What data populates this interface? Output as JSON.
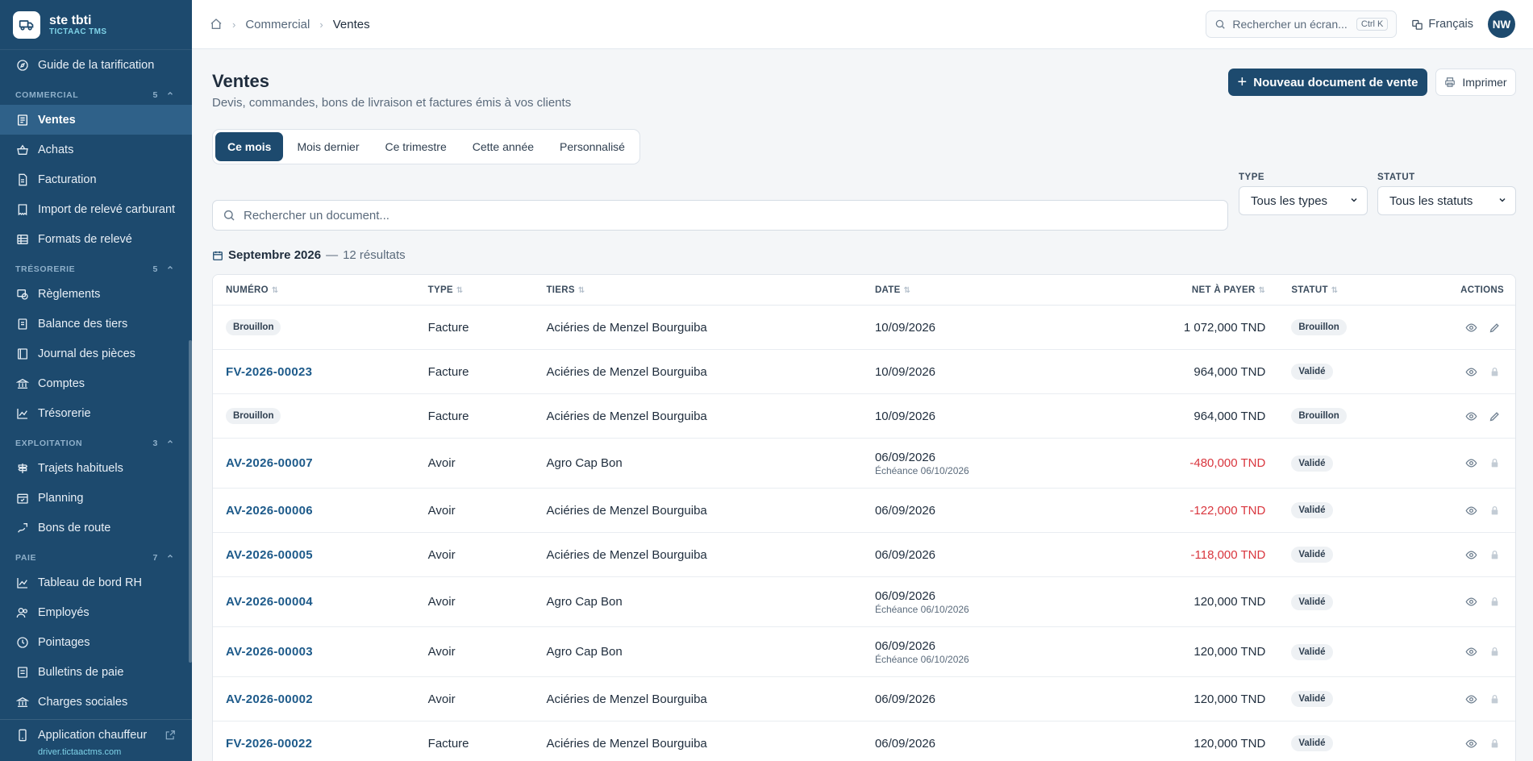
{
  "brand": {
    "name": "ste tbti",
    "subtitle": "TICTAAC TMS"
  },
  "sidebar": {
    "top_item": {
      "label": "Guide de la tarification",
      "icon": "compass-icon"
    },
    "sections": [
      {
        "title": "COMMERCIAL",
        "count": "5",
        "items": [
          {
            "label": "Ventes",
            "icon": "document-icon",
            "active": true
          },
          {
            "label": "Achats",
            "icon": "basket-icon"
          },
          {
            "label": "Facturation",
            "icon": "invoice-icon"
          },
          {
            "label": "Import de relevé carburant",
            "icon": "receipt-icon"
          },
          {
            "label": "Formats de relevé",
            "icon": "grid-icon"
          }
        ]
      },
      {
        "title": "TRÉSORERIE",
        "count": "5",
        "items": [
          {
            "label": "Règlements",
            "icon": "payment-icon"
          },
          {
            "label": "Balance des tiers",
            "icon": "balance-icon"
          },
          {
            "label": "Journal des pièces",
            "icon": "journal-icon"
          },
          {
            "label": "Comptes",
            "icon": "bank-icon"
          },
          {
            "label": "Trésorerie",
            "icon": "chart-line-icon"
          }
        ]
      },
      {
        "title": "EXPLOITATION",
        "count": "3",
        "items": [
          {
            "label": "Trajets habituels",
            "icon": "signpost-icon"
          },
          {
            "label": "Planning",
            "icon": "calendar-icon"
          },
          {
            "label": "Bons de route",
            "icon": "route-icon"
          }
        ]
      },
      {
        "title": "PAIE",
        "count": "7",
        "items": [
          {
            "label": "Tableau de bord RH",
            "icon": "chart-line-icon"
          },
          {
            "label": "Employés",
            "icon": "users-icon"
          },
          {
            "label": "Pointages",
            "icon": "clock-icon"
          },
          {
            "label": "Bulletins de paie",
            "icon": "payslip-icon"
          },
          {
            "label": "Charges sociales",
            "icon": "bank-icon"
          }
        ]
      }
    ],
    "footer": {
      "app_label": "Application chauffeur",
      "url": "driver.tictaactms.com"
    }
  },
  "topbar": {
    "breadcrumb": [
      "Commercial",
      "Ventes"
    ],
    "search_placeholder": "Rechercher un écran...",
    "shortcut": "Ctrl K",
    "language": "Français",
    "avatar_initials": "NW"
  },
  "page": {
    "title": "Ventes",
    "subtitle": "Devis, commandes, bons de livraison et factures émis à vos clients",
    "new_button": "Nouveau document de vente",
    "print_button": "Imprimer"
  },
  "periods": [
    "Ce mois",
    "Mois dernier",
    "Ce trimestre",
    "Cette année",
    "Personnalisé"
  ],
  "active_period": "Ce mois",
  "filters": {
    "type_label": "TYPE",
    "type_value": "Tous les types",
    "status_label": "STATUT",
    "status_value": "Tous les statuts"
  },
  "doc_search_placeholder": "Rechercher un document...",
  "results": {
    "month": "Septembre 2026",
    "dash": "—",
    "count": "12 résultats"
  },
  "table": {
    "headers": {
      "num": "NUMÉRO",
      "type": "TYPE",
      "tiers": "TIERS",
      "date": "DATE",
      "net": "NET À PAYER",
      "status": "STATUT",
      "actions": "ACTIONS"
    },
    "rows": [
      {
        "num": "Brouillon",
        "draft": true,
        "type": "Facture",
        "tiers": "Aciéries de Menzel Bourguiba",
        "date": "10/09/2026",
        "due": "",
        "net": "1 072,000 TND",
        "negative": false,
        "status": "Brouillon",
        "editable": true
      },
      {
        "num": "FV-2026-00023",
        "draft": false,
        "type": "Facture",
        "tiers": "Aciéries de Menzel Bourguiba",
        "date": "10/09/2026",
        "due": "",
        "net": "964,000 TND",
        "negative": false,
        "status": "Validé",
        "editable": false
      },
      {
        "num": "Brouillon",
        "draft": true,
        "type": "Facture",
        "tiers": "Aciéries de Menzel Bourguiba",
        "date": "10/09/2026",
        "due": "",
        "net": "964,000 TND",
        "negative": false,
        "status": "Brouillon",
        "editable": true
      },
      {
        "num": "AV-2026-00007",
        "draft": false,
        "type": "Avoir",
        "tiers": "Agro Cap Bon",
        "date": "06/09/2026",
        "due": "Échéance 06/10/2026",
        "net": "-480,000 TND",
        "negative": true,
        "status": "Validé",
        "editable": false
      },
      {
        "num": "AV-2026-00006",
        "draft": false,
        "type": "Avoir",
        "tiers": "Aciéries de Menzel Bourguiba",
        "date": "06/09/2026",
        "due": "",
        "net": "-122,000 TND",
        "negative": true,
        "status": "Validé",
        "editable": false
      },
      {
        "num": "AV-2026-00005",
        "draft": false,
        "type": "Avoir",
        "tiers": "Aciéries de Menzel Bourguiba",
        "date": "06/09/2026",
        "due": "",
        "net": "-118,000 TND",
        "negative": true,
        "status": "Validé",
        "editable": false
      },
      {
        "num": "AV-2026-00004",
        "draft": false,
        "type": "Avoir",
        "tiers": "Agro Cap Bon",
        "date": "06/09/2026",
        "due": "Échéance 06/10/2026",
        "net": "120,000 TND",
        "negative": false,
        "status": "Validé",
        "editable": false
      },
      {
        "num": "AV-2026-00003",
        "draft": false,
        "type": "Avoir",
        "tiers": "Agro Cap Bon",
        "date": "06/09/2026",
        "due": "Échéance 06/10/2026",
        "net": "120,000 TND",
        "negative": false,
        "status": "Validé",
        "editable": false
      },
      {
        "num": "AV-2026-00002",
        "draft": false,
        "type": "Avoir",
        "tiers": "Aciéries de Menzel Bourguiba",
        "date": "06/09/2026",
        "due": "",
        "net": "120,000 TND",
        "negative": false,
        "status": "Validé",
        "editable": false
      },
      {
        "num": "FV-2026-00022",
        "draft": false,
        "type": "Facture",
        "tiers": "Aciéries de Menzel Bourguiba",
        "date": "06/09/2026",
        "due": "",
        "net": "120,000 TND",
        "negative": false,
        "status": "Validé",
        "editable": false
      }
    ]
  },
  "colors": {
    "sidebar": "#1d4a6e",
    "accent": "#1d4a6e",
    "negative": "#d9363e",
    "link": "#1d5a8a"
  }
}
